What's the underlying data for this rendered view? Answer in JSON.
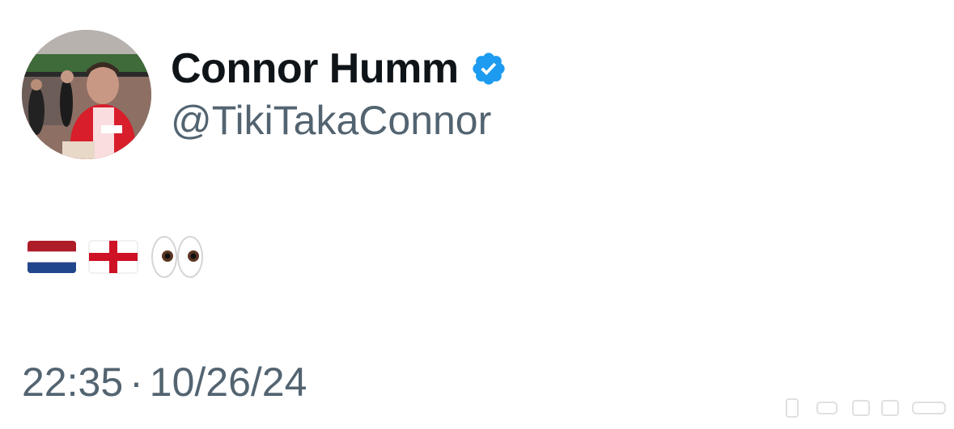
{
  "tweet": {
    "author": {
      "display_name": "Connor Humm",
      "handle": "@TikiTakaConnor",
      "verified": true,
      "verified_color": "#1d9bf0",
      "avatar": "profile-photo"
    },
    "content": {
      "emojis": [
        "netherlands-flag",
        "england-flag",
        "eyes"
      ]
    },
    "time": "22:35",
    "separator": "·",
    "date": "10/26/24"
  },
  "colors": {
    "name": "#0f1419",
    "secondary": "#536471",
    "background": "#ffffff"
  }
}
